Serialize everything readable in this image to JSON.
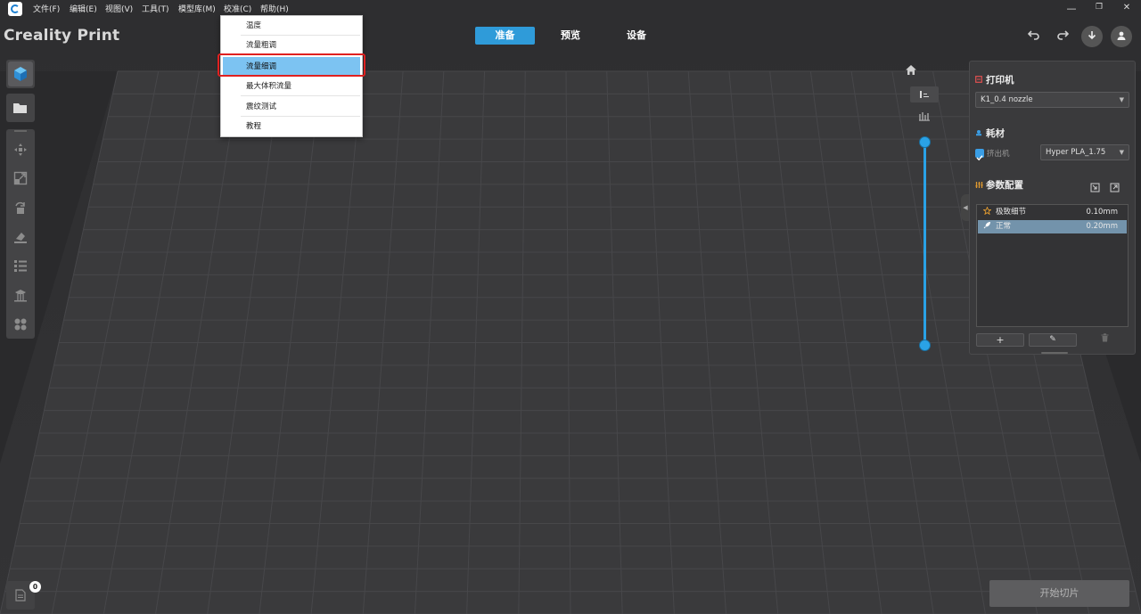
{
  "app": {
    "title": "Creality Print"
  },
  "menubar": {
    "items": [
      {
        "label": "文件(F)"
      },
      {
        "label": "编辑(E)"
      },
      {
        "label": "视图(V)"
      },
      {
        "label": "工具(T)"
      },
      {
        "label": "模型库(M)"
      },
      {
        "label": "校准(C)"
      },
      {
        "label": "帮助(H)"
      }
    ],
    "window_controls": {
      "minimize": "—",
      "restore": "❐",
      "close": "✕"
    }
  },
  "calibration_menu": {
    "items": [
      {
        "label": "温度",
        "highlighted": false
      },
      {
        "label": "流量粗调",
        "highlighted": false
      },
      {
        "label": "流量细调",
        "highlighted": true
      },
      {
        "label": "最大体积流量",
        "highlighted": false
      },
      {
        "label": "震纹测试",
        "highlighted": false
      },
      {
        "label": "教程",
        "highlighted": false
      }
    ]
  },
  "top_tabs": [
    {
      "label": "准备",
      "active": true
    },
    {
      "label": "预览",
      "active": false
    },
    {
      "label": "设备",
      "active": false
    }
  ],
  "top_right_icons": [
    "undo-icon",
    "redo-icon",
    "download-icon",
    "user-icon"
  ],
  "left_toolbar": {
    "icons": [
      "cube-icon",
      "open-folder-icon",
      "move-icon",
      "scale-icon",
      "rotate-icon",
      "lay-flat-icon",
      "layout-list-icon",
      "support-icon",
      "arrange-icon"
    ]
  },
  "viewport": {
    "icons": [
      "home-icon",
      "layer-view-icon",
      "slice-view-icon"
    ]
  },
  "right_panel": {
    "printer": {
      "title": "打印机",
      "selected": "K1_0.4 nozzle"
    },
    "filament": {
      "title": "耗材",
      "extruder_label": "挤出机",
      "extruder_checked": true,
      "selected": "Hyper PLA_1.75"
    },
    "profiles": {
      "title": "参数配置",
      "items": [
        {
          "name": "极致细节",
          "value": "0.10mm",
          "selected": false
        },
        {
          "name": "正常",
          "value": "0.20mm",
          "selected": true
        }
      ],
      "buttons": {
        "add": "+",
        "edit": "✎",
        "delete": "🗑"
      }
    }
  },
  "bottom": {
    "slice_button": "开始切片",
    "model_count": "0"
  },
  "colors": {
    "accent": "#2f9bd9",
    "background": "#2f2f31",
    "highlight_red": "#e02020"
  }
}
